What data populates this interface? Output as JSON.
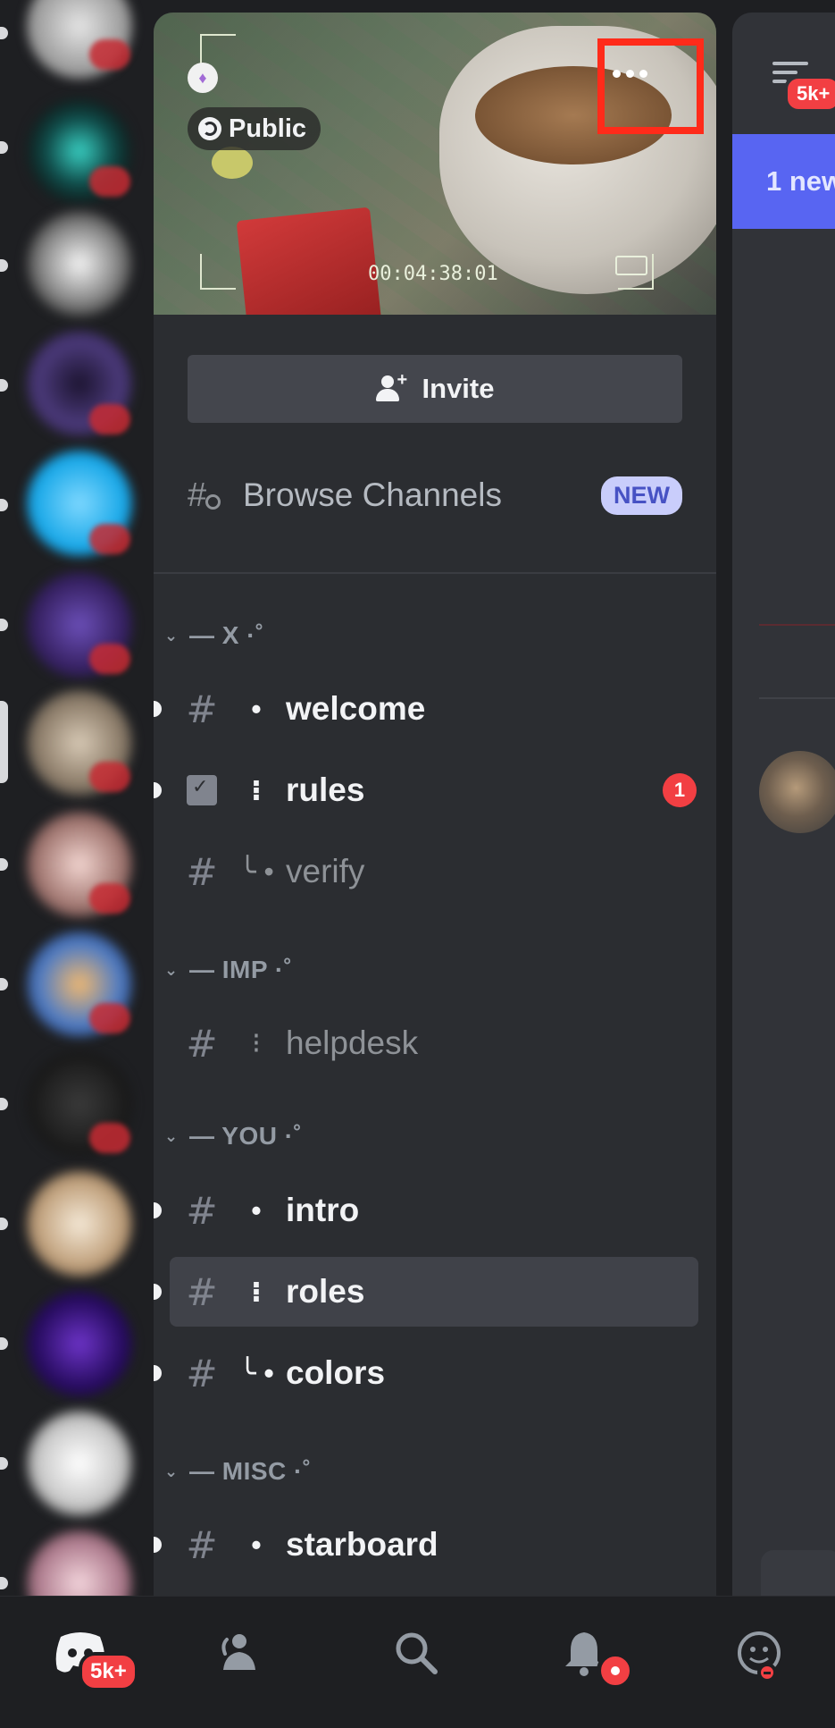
{
  "server": {
    "visibility_label": "Public",
    "video_timecode": "00:04:38:01"
  },
  "actions": {
    "invite_label": "Invite",
    "browse_channels_label": "Browse Channels",
    "browse_channels_badge": "NEW"
  },
  "categories": [
    {
      "name": "— X ·˚",
      "channels": [
        {
          "prefix": "•",
          "name": "welcome",
          "icon": "hash-icon",
          "unread": true
        },
        {
          "prefix": "⁝",
          "name": "rules",
          "icon": "rules-icon",
          "unread": true,
          "mentions": "1"
        },
        {
          "prefix": "╰ •",
          "name": "verify",
          "icon": "hash-icon",
          "unread": false
        }
      ]
    },
    {
      "name": "— IMP ·˚",
      "channels": [
        {
          "prefix": "⁝",
          "name": "helpdesk",
          "icon": "hash-icon",
          "unread": false
        }
      ]
    },
    {
      "name": "— YOU ·˚",
      "channels": [
        {
          "prefix": "•",
          "name": "intro",
          "icon": "hash-icon",
          "unread": true
        },
        {
          "prefix": "⁝",
          "name": "roles",
          "icon": "hash-icon",
          "unread": true,
          "selected": true
        },
        {
          "prefix": "╰ •",
          "name": "colors",
          "icon": "hash-icon",
          "unread": true
        }
      ]
    },
    {
      "name": "— MISC ·˚",
      "channels": [
        {
          "prefix": "•",
          "name": "starboard",
          "icon": "hash-icon",
          "unread": true
        }
      ]
    }
  ],
  "chat": {
    "inbox_badge": "5k+",
    "new_messages_banner": "1 new"
  },
  "bottom_nav": {
    "home_badge": "5k+",
    "tabs": [
      "home-icon",
      "friends-icon",
      "search-icon",
      "notifications-icon",
      "profile-icon"
    ]
  },
  "colors": {
    "accent": "#5865f2",
    "danger": "#f23f43",
    "panel": "#2b2d31",
    "highlight_box": "#ff2b1a"
  }
}
